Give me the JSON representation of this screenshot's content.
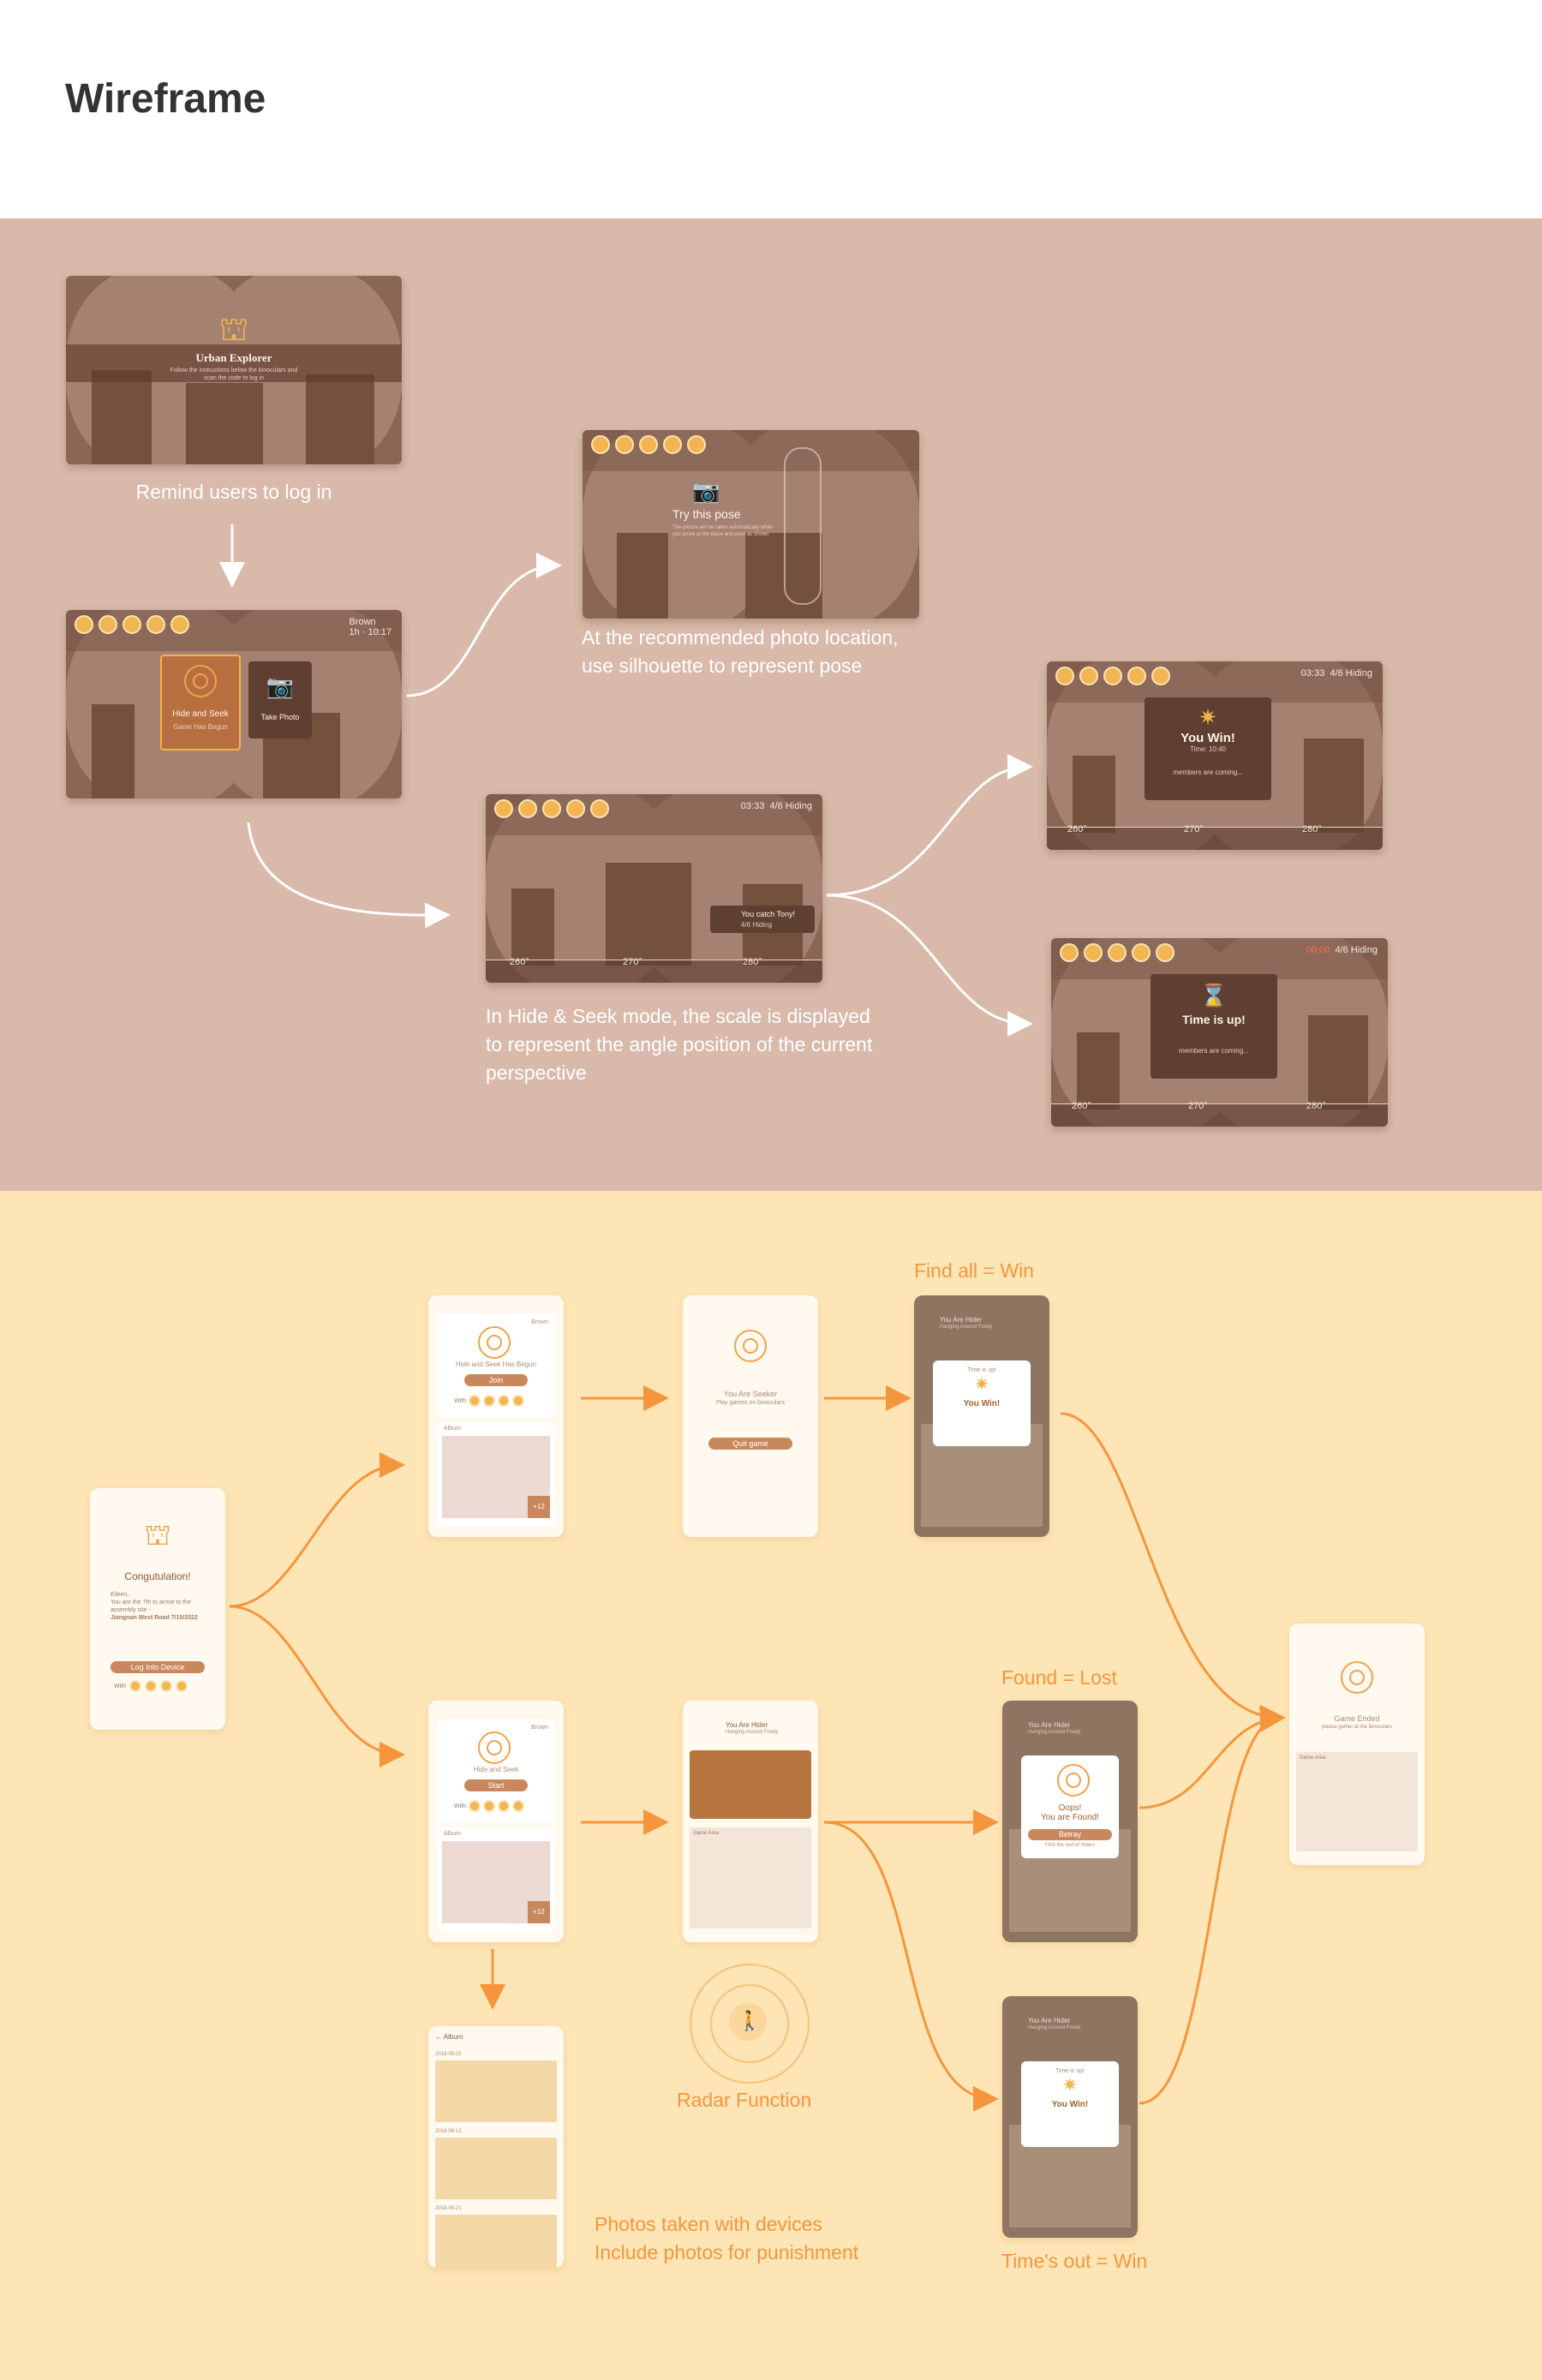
{
  "page": {
    "title": "Wireframe"
  },
  "colors": {
    "top_band": "#d8b9aa",
    "bottom_band": "#fde5b6",
    "screen": "#8a6655",
    "accent": "#f5963d",
    "dialog": "#5e3f31"
  },
  "top": {
    "login_screen": {
      "title": "Urban Explorer",
      "subtitle": "Follow the instructions below the binoculars and scan the code to log in",
      "caption": "Remind users to log in"
    },
    "mode_screen": {
      "hide_seek": "Hide and Seek",
      "hide_seek_sub": "Game Has Begun",
      "take_photo": "Take Photo",
      "status": "Brown",
      "status_time": "1h · 10:17"
    },
    "pose_screen": {
      "title": "Try this pose",
      "body": "The picture will be taken automatically when you arrive at the place and pose as shown",
      "caption_lines": [
        "At the recommended photo location,",
        "use silhouette to represent pose"
      ]
    },
    "seek_screen": {
      "timer": "03:33",
      "hiding": "4/6 Hiding",
      "toast": "You catch Tony!",
      "toast_sub": "4/6 Hiding",
      "ticks": [
        "260°",
        "270°",
        "280°"
      ],
      "caption_lines": [
        "In Hide & Seek mode, the scale is displayed",
        "to represent the angle position of the current",
        "perspective"
      ]
    },
    "win_screen": {
      "timer": "03:33",
      "hiding": "4/6 Hiding",
      "title": "You Win!",
      "sub": "Time: 10:40",
      "note": "members are coming...",
      "ticks": [
        "260°",
        "270°",
        "280°"
      ]
    },
    "timeup_screen": {
      "timer": "00:00",
      "hiding": "4/6 Hiding",
      "title": "Time is up!",
      "note": "members are coming...",
      "ticks": [
        "260°",
        "270°",
        "280°"
      ]
    }
  },
  "bottom": {
    "congrats": {
      "title": "Congutulation!",
      "line1": "Eileen,",
      "line2": "You are the 7th to arrive to the assembly site -",
      "line3": "Jiangnan West Road 7/10/2022",
      "button": "Log Into Device",
      "with": "With"
    },
    "seeker_lobby": {
      "tag": "Brown",
      "title": "Hide and Seek Has Begun",
      "button": "Join",
      "with": "With",
      "album": "Album",
      "more": "+12"
    },
    "seeker_role": {
      "title": "You Are Seeker",
      "sub": "Play games on binoculars",
      "button": "Quit game"
    },
    "seeker_win": {
      "header": "You Are Hider",
      "header_sub": "Hanging Around Freely",
      "popup_top": "Time is up!",
      "popup_title": "You Win!"
    },
    "hider_lobby": {
      "tag": "Brown",
      "title": "Hide and Seek",
      "button": "Start",
      "with": "With",
      "album": "Album",
      "more": "+12"
    },
    "hider_role": {
      "title": "You Are Hider",
      "sub": "Hanging Around Freely",
      "map_label": "Game Area"
    },
    "found": {
      "header": "You Are Hider",
      "header_sub": "Hanging Around Freely",
      "line1": "Oops!",
      "line2": "You are Found!",
      "button": "Betray",
      "note": "Find the rest of hiders"
    },
    "timeout": {
      "header": "You Are Hider",
      "header_sub": "Hanging Around Freely",
      "popup_top": "Time is up!",
      "popup_title": "You Win!"
    },
    "ended": {
      "title": "Game Ended",
      "sub": "please gather at the binoculars",
      "map_label": "Game Area"
    },
    "album": {
      "back": "Album",
      "dates": [
        "2018-09-22",
        "2018-08-12",
        "2018-05-21"
      ]
    },
    "labels": {
      "find_all": "Find all = Win",
      "found_lost": "Found = Lost",
      "timeout_win": "Time's out = Win",
      "radar": "Radar Function",
      "photos_lines": [
        "Photos taken with devices",
        "Include photos for punishment"
      ]
    }
  }
}
